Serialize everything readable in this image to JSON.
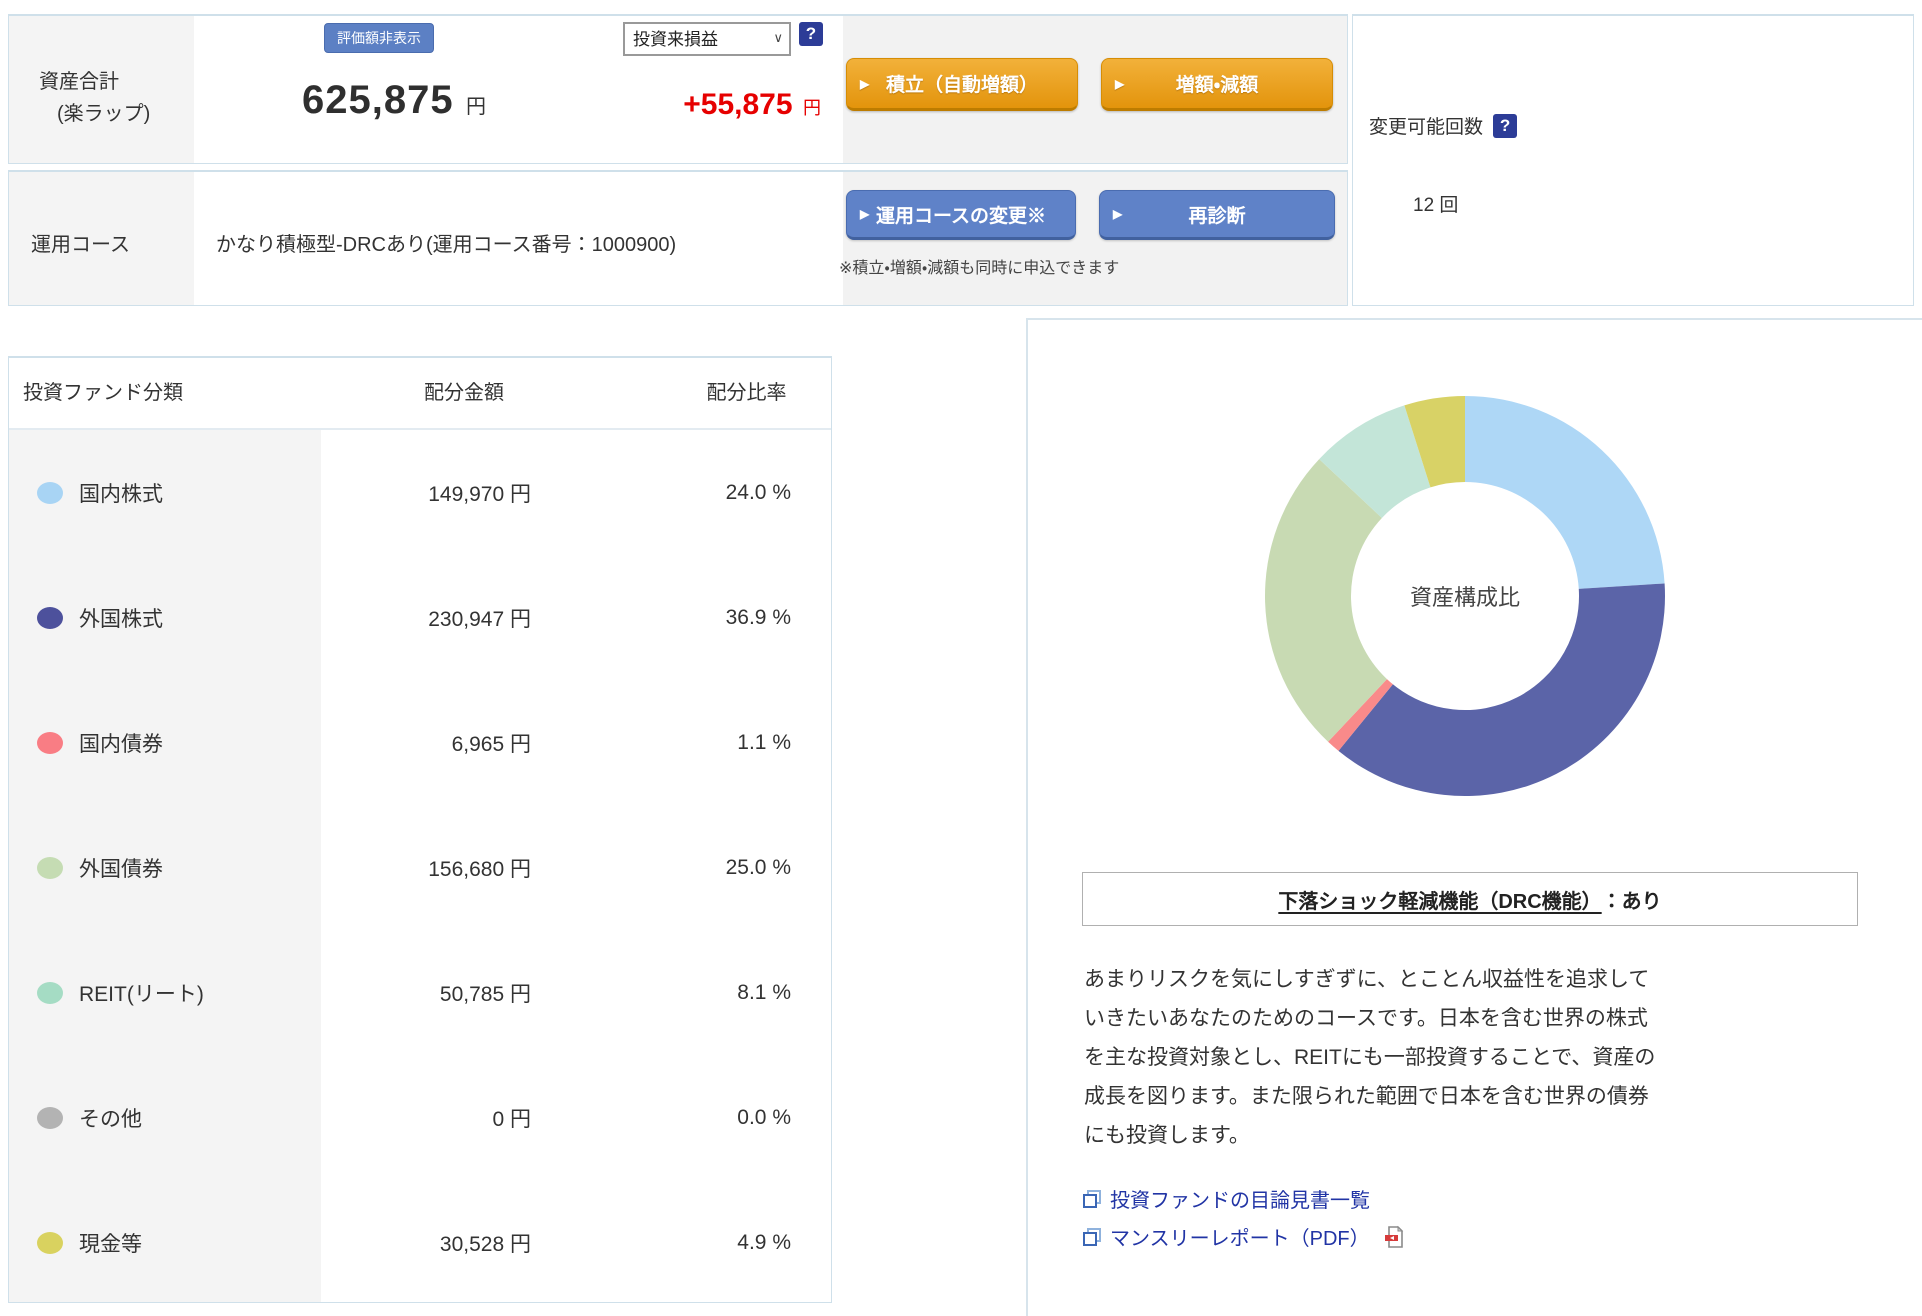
{
  "colors": {
    "panel_border": "#cfe0ea",
    "hide_value_button_bg": "#5c80c4",
    "orange_button_top": "#f2b13a",
    "orange_button_bottom": "#e3940c",
    "blue_action_button": "#5f82c8",
    "pl_red": "#e60000",
    "link_blue": "#2134a5",
    "help_icon_bg": "#2c3c97",
    "label_cell_bg": "#f4f4f4"
  },
  "icons": {
    "arrow": "▶",
    "chevron": "∨",
    "help": "?"
  },
  "summary": {
    "asset_label_line1": "資産合計",
    "asset_label_line2": "(楽ラップ)",
    "hide_value_button": "評価額非表示",
    "total_amount": "625,875",
    "currency_unit": "円",
    "pl_select_value": "投資来損益",
    "pl_amount": "+55,875",
    "reserve_button": "積立（自動増額）",
    "adjust_button": "増額・減額",
    "course_label": "運用コース",
    "course_value": "かなり積極型-DRCあり(運用コース番号：1000900)",
    "change_course_button": "運用コースの変更※",
    "rediagnose_button": "再診断",
    "apply_note": "※積立・増額・減額も同時に申込できます",
    "change_count_label": "変更可能回数",
    "change_count_value": "12 回"
  },
  "allocation_table": {
    "headers": [
      "投資ファンド分類",
      "配分金額",
      "配分比率"
    ],
    "rows": [
      {
        "label": "国内株式",
        "amount": "149,970 円",
        "ratio": "24.0 %",
        "dot_color": "#a8d4f4"
      },
      {
        "label": "外国株式",
        "amount": "230,947 円",
        "ratio": "36.9 %",
        "dot_color": "#4d519c"
      },
      {
        "label": "国内債券",
        "amount": "6,965 円",
        "ratio": "1.1 %",
        "dot_color": "#f97d84"
      },
      {
        "label": "外国債券",
        "amount": "156,680 円",
        "ratio": "25.0 %",
        "dot_color": "#c5dcb3"
      },
      {
        "label": "REIT(リート)",
        "amount": "50,785 円",
        "ratio": "8.1 %",
        "dot_color": "#a5dcc4"
      },
      {
        "label": "その他",
        "amount": "0 円",
        "ratio": "0.0 %",
        "dot_color": "#b3b3b3"
      },
      {
        "label": "現金等",
        "amount": "30,528 円",
        "ratio": "4.9 %",
        "dot_color": "#d9d25f"
      }
    ]
  },
  "chart_data": {
    "type": "pie",
    "donut": true,
    "center_label": "資産構成比",
    "start_angle_deg": -90,
    "direction": "clockwise",
    "segments": [
      {
        "label": "国内株式",
        "value": 24.0,
        "color": "#aed7f6"
      },
      {
        "label": "外国株式",
        "value": 36.9,
        "color": "#5b64a8"
      },
      {
        "label": "国内債券",
        "value": 1.1,
        "color": "#f98a8a"
      },
      {
        "label": "外国債券",
        "value": 25.0,
        "color": "#c8dab3"
      },
      {
        "label": "REIT(リート)",
        "value": 8.1,
        "color": "#c3e5d8"
      },
      {
        "label": "その他",
        "value": 0.0,
        "color": "#b3b3b3"
      },
      {
        "label": "現金等",
        "value": 4.9,
        "color": "#d8d266"
      }
    ]
  },
  "drc_box": {
    "title": "下落ショック軽減機能（DRC機能）",
    "status": "：あり"
  },
  "course_description": "あまりリスクを気にしすぎずに、とことん収益性を追求して\nいきたいあなたのためのコースです。日本を含む世界の株式\nを主な投資対象とし、REITにも一部投資することで、資産の\n成長を図ります。また限られた範囲で日本を含む世界の債券\nにも投資します。",
  "links": {
    "prospectus": "投資ファンドの目論見書一覧",
    "monthly_report": "マンスリーレポート（PDF）"
  }
}
